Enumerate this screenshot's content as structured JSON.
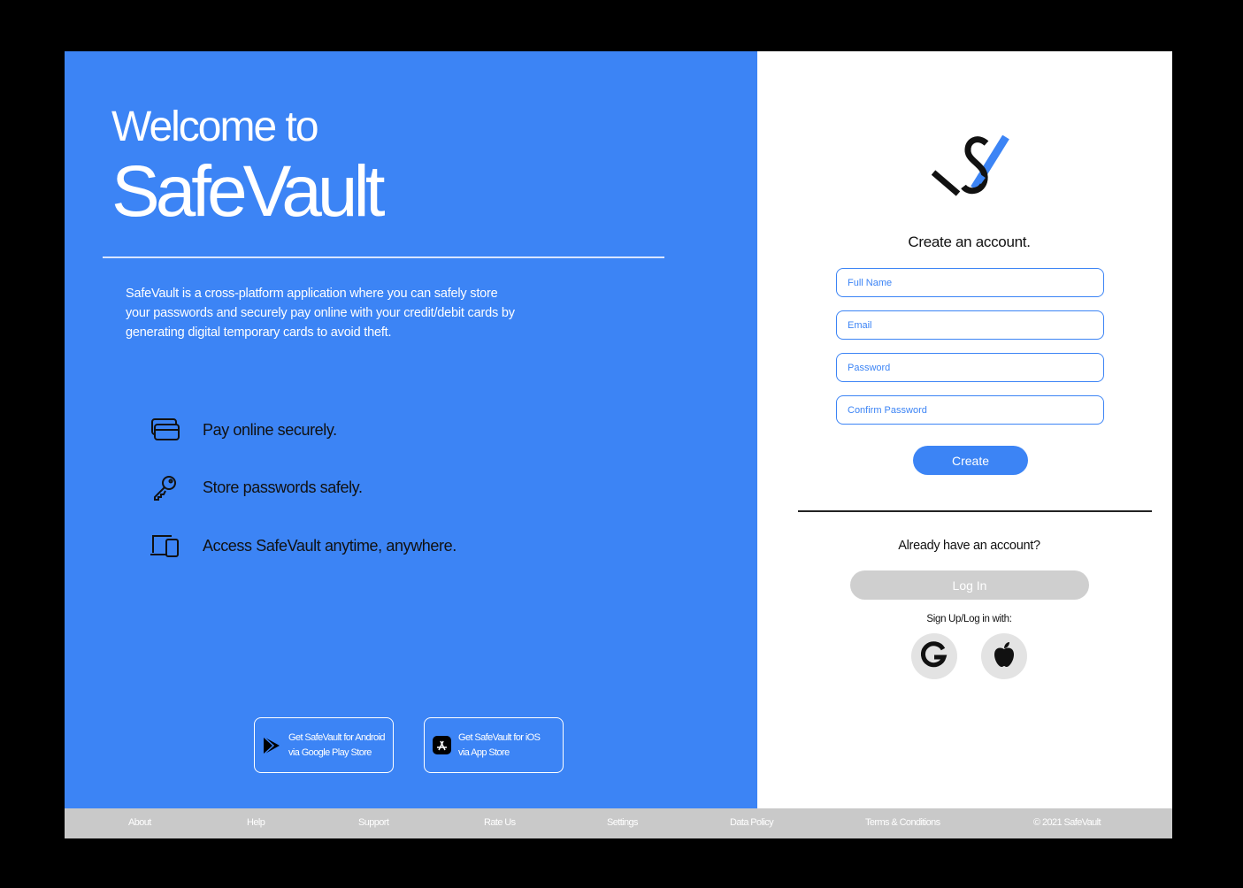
{
  "hero": {
    "welcome": "Welcome to",
    "brand": "SafeVault",
    "description": "SafeVault is a cross-platform application where you can safely store your passwords and securely pay online with your credit/debit cards by generating digital temporary cards to avoid theft."
  },
  "features": [
    {
      "icon": "cards-icon",
      "text": "Pay online securely."
    },
    {
      "icon": "key-icon",
      "text": "Store passwords safely."
    },
    {
      "icon": "devices-icon",
      "text": "Access SafeVault anytime, anywhere."
    }
  ],
  "stores": {
    "android": {
      "line1": "Get SafeVault for Android",
      "line2": "via Google Play Store",
      "icon": "google-play-icon"
    },
    "ios": {
      "line1": "Get SafeVault for iOS",
      "line2": "via App Store",
      "icon": "app-store-icon"
    }
  },
  "signup": {
    "title": "Create an account.",
    "full_name_placeholder": "Full Name",
    "email_placeholder": "Email",
    "password_placeholder": "Password",
    "confirm_password_placeholder": "Confirm Password",
    "create_label": "Create",
    "already": "Already have an account?",
    "login_label": "Log In",
    "social_label": "Sign Up/Log in with:",
    "social": [
      "google-icon",
      "apple-icon"
    ]
  },
  "footer": {
    "about": "About",
    "help": "Help",
    "support": "Support",
    "rate": "Rate Us",
    "settings": "Settings",
    "policy": "Data Policy",
    "terms": "Terms & Conditions",
    "copyright": "© 2021 SafeVault"
  },
  "colors": {
    "accent": "#3c84f5",
    "footer": "#c9c9c9",
    "muted_button": "#cfcfcf"
  }
}
